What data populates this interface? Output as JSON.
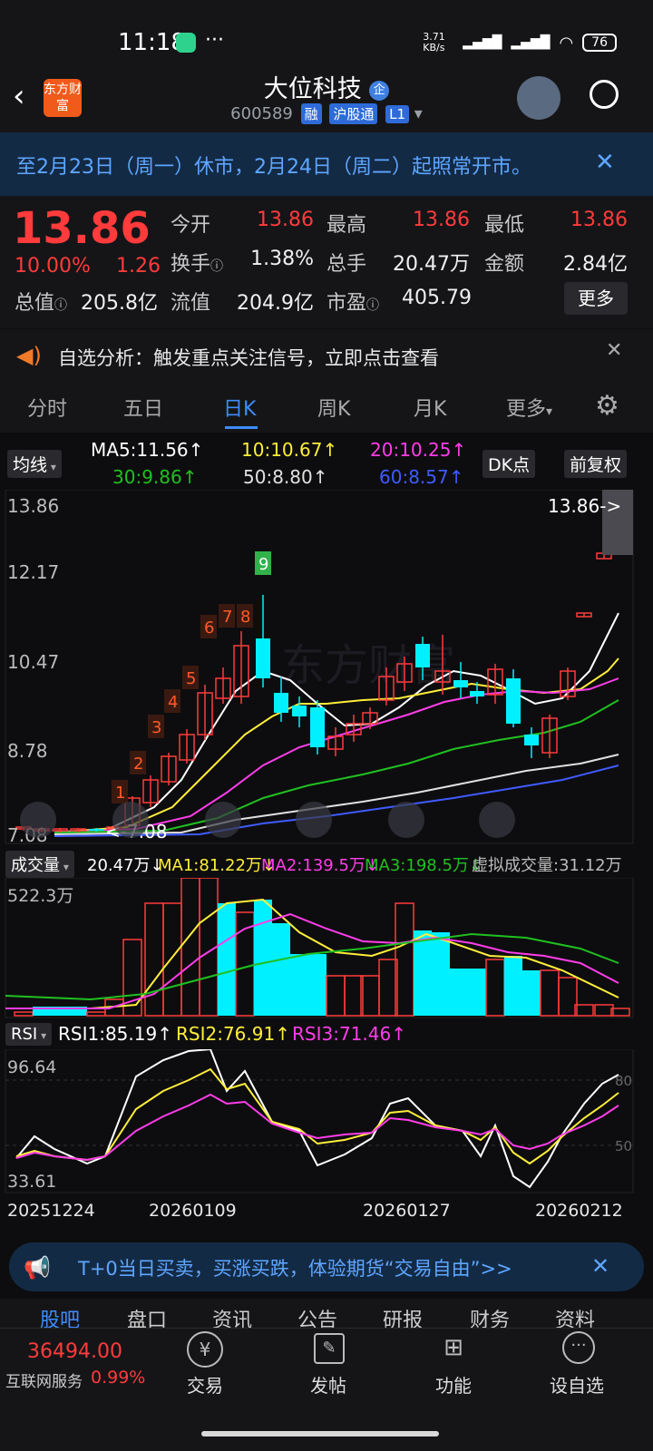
{
  "status": {
    "time": "11:18",
    "net_speed": "3.71 KB/s",
    "battery": "76",
    "more_dots": "···"
  },
  "header": {
    "title": "大位科技",
    "badge": "企",
    "code": "600589",
    "tags": [
      "融",
      "沪股通",
      "L1"
    ],
    "logo_text": "东方财富"
  },
  "notice": {
    "text": "至2月23日（周一）休市，2月24日（周二）起照常开市。"
  },
  "quote": {
    "price": "13.86",
    "pct": "10.00%",
    "change": "1.26",
    "stats": [
      {
        "label": "今开",
        "value": "13.86",
        "color": "red"
      },
      {
        "label": "最高",
        "value": "13.86",
        "color": "red"
      },
      {
        "label": "最低",
        "value": "13.86",
        "color": "red"
      },
      {
        "label": "换手",
        "value": "1.38%",
        "color": "white"
      },
      {
        "label": "总手",
        "value": "20.47万",
        "color": "white"
      },
      {
        "label": "金额",
        "value": "2.84亿",
        "color": "white"
      },
      {
        "label": "总值",
        "value": "205.8亿",
        "color": "white"
      },
      {
        "label": "流值",
        "value": "204.9亿",
        "color": "white"
      },
      {
        "label": "市盈",
        "value": "405.79",
        "color": "white"
      }
    ],
    "more_label": "更多"
  },
  "alert": {
    "text": "自选分析：触发重点关注信号，立即点击查看"
  },
  "tabs": [
    {
      "label": "分时",
      "active": false
    },
    {
      "label": "五日",
      "active": false
    },
    {
      "label": "日K",
      "active": true
    },
    {
      "label": "周K",
      "active": false
    },
    {
      "label": "月K",
      "active": false
    },
    {
      "label": "更多",
      "active": false
    }
  ],
  "ma": {
    "selector": "均线",
    "ma5": "MA5:11.56↑",
    "ma10": "10:10.67↑",
    "ma20": "20:10.25↑",
    "ma30": "30:9.86↑",
    "ma50": "50:8.80↑",
    "ma60": "60:8.57↑",
    "dk_label": "DK点",
    "adj_label": "前复权"
  },
  "kchart": {
    "y_labels": [
      "13.86",
      "12.17",
      "10.47",
      "8.78",
      "7.08"
    ],
    "high_marker": "13.86->",
    "low_marker": "<-7.08",
    "seq_labels": [
      "1",
      "2",
      "3",
      "4",
      "5",
      "6",
      "7",
      "8",
      "9"
    ],
    "watermark": "东方财富"
  },
  "volume": {
    "selector": "成交量",
    "v": "20.47万↓",
    "ma1": "MA1:81.22万↓",
    "ma2": "MA2:139.5万↓",
    "ma3": "MA3:198.5万↓",
    "virtual": "虚拟成交量:31.12万",
    "max_label": "522.3万"
  },
  "rsi": {
    "selector": "RSI",
    "rsi1": "RSI1:85.19↑",
    "rsi2": "RSI2:76.91↑",
    "rsi3": "RSI3:71.46↑",
    "top_label": "96.64",
    "bottom_label": "33.61",
    "line80": "80",
    "line50": "50"
  },
  "dates": [
    "20251224",
    "20260109",
    "20260127",
    "20260212"
  ],
  "promo": {
    "text": "T+0当日买卖，买涨买跌，体验期货“交易自由”>>"
  },
  "bottom_tabs": [
    "股吧",
    "盘口",
    "资讯",
    "公告",
    "研报",
    "财务",
    "资料"
  ],
  "bottom_nav": {
    "index_value": "36494.00",
    "index_name": "互联网服务",
    "index_pct": "0.99%",
    "items": [
      "交易",
      "发帖",
      "功能",
      "设自选"
    ]
  },
  "colors": {
    "up": "#ff3b3b",
    "down": "#00f0ff",
    "accent": "#3f8cff",
    "ma5": "#ffffff",
    "ma10": "#ffee3a",
    "ma20": "#ff3dea",
    "ma30": "#20c020",
    "ma50": "#e0e0e0",
    "ma60": "#3f5bff"
  }
}
